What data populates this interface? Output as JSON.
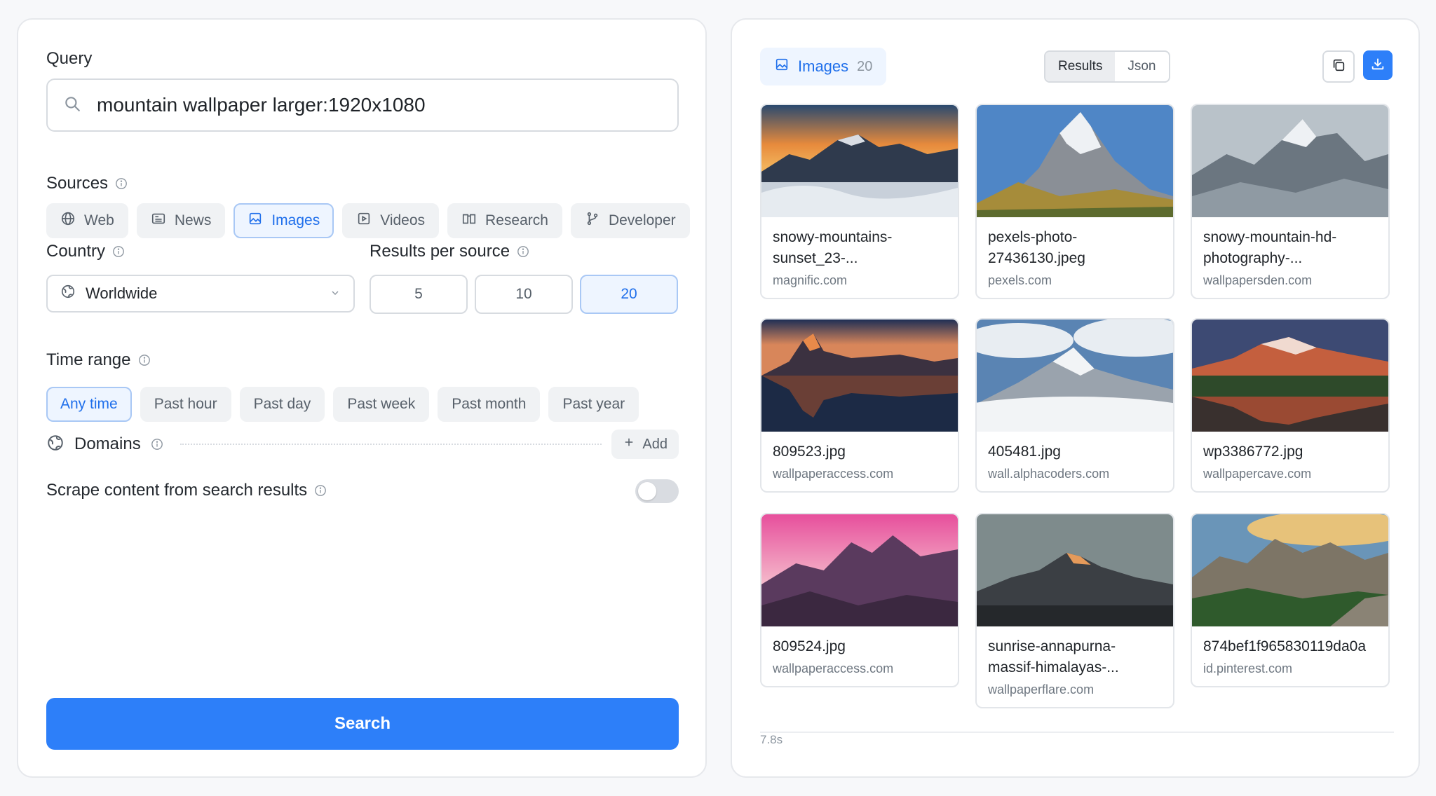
{
  "query": {
    "label": "Query",
    "value": "mountain wallpaper larger:1920x1080"
  },
  "sources": {
    "label": "Sources",
    "items": [
      {
        "label": "Web",
        "icon": "globe-icon"
      },
      {
        "label": "News",
        "icon": "newspaper-icon"
      },
      {
        "label": "Images",
        "icon": "image-icon",
        "active": true
      },
      {
        "label": "Videos",
        "icon": "video-icon"
      },
      {
        "label": "Research",
        "icon": "book-icon"
      },
      {
        "label": "Developer",
        "icon": "git-branch-icon"
      }
    ]
  },
  "country": {
    "label": "Country",
    "value": "Worldwide"
  },
  "results_per_source": {
    "label": "Results per source",
    "options": [
      "5",
      "10",
      "20"
    ],
    "selected": "20"
  },
  "time_range": {
    "label": "Time range",
    "options": [
      "Any time",
      "Past hour",
      "Past day",
      "Past week",
      "Past month",
      "Past year"
    ],
    "selected": "Any time"
  },
  "domains": {
    "label": "Domains",
    "add_label": "Add"
  },
  "scrape": {
    "label": "Scrape content from search results",
    "enabled": false
  },
  "search_button": "Search",
  "results": {
    "tab_label": "Images",
    "tab_count": "20",
    "view_options": [
      "Results",
      "Json"
    ],
    "view_selected": "Results",
    "elapsed": "7.8s",
    "images": [
      {
        "title": "snowy-mountains-\nsunset_23-...",
        "source": "magnific.com"
      },
      {
        "title": "pexels-photo-\n27436130.jpeg",
        "source": "pexels.com"
      },
      {
        "title": "snowy-mountain-hd-\nphotography-...",
        "source": "wallpapersden.com"
      },
      {
        "title": "809523.jpg",
        "source": "wallpaperaccess.com"
      },
      {
        "title": "405481.jpg",
        "source": "wall.alphacoders.com"
      },
      {
        "title": "wp3386772.jpg",
        "source": "wallpapercave.com"
      },
      {
        "title": "809524.jpg",
        "source": "wallpaperaccess.com"
      },
      {
        "title": "sunrise-annapurna-\nmassif-himalayas-...",
        "source": "wallpaperflare.com"
      },
      {
        "title": "874bef1f965830119da0a",
        "source": "id.pinterest.com"
      }
    ]
  },
  "colors": {
    "accent": "#2d7ff9",
    "accent_light_bg": "#eef5ff"
  }
}
